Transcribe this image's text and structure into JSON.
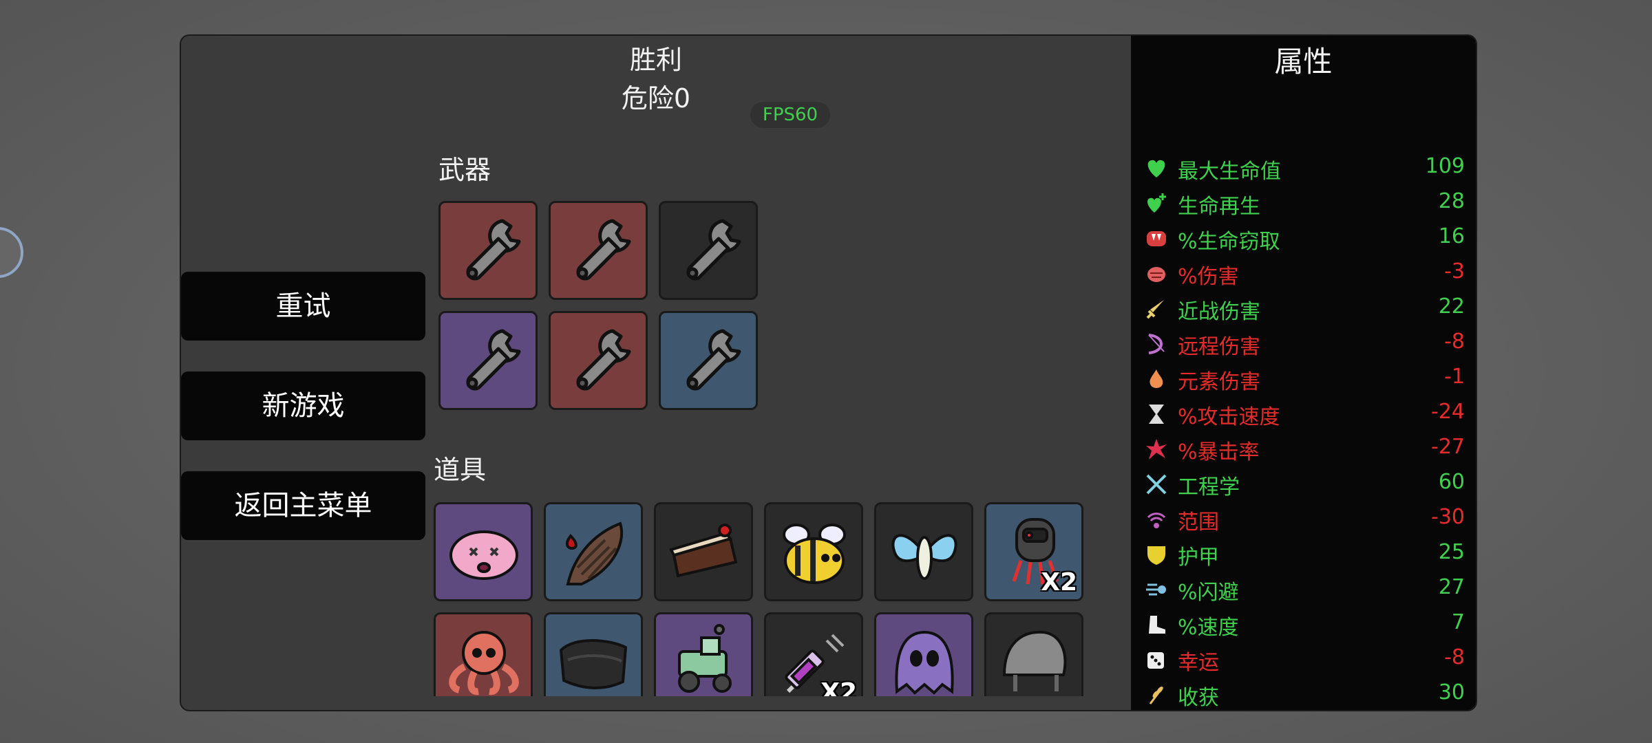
{
  "header": {
    "result": "胜利",
    "danger": "危险0",
    "fps": "FPS60"
  },
  "menu": {
    "retry": "重试",
    "new_game": "新游戏",
    "main_menu": "返回主菜单"
  },
  "weapons": {
    "label": "武器",
    "slots": [
      {
        "icon": "wrench-icon",
        "tier_color": "#7a3d3d"
      },
      {
        "icon": "wrench-icon",
        "tier_color": "#7a3d3d"
      },
      {
        "icon": "wrench-icon",
        "tier_color": "#2a2a2a"
      },
      {
        "icon": "wrench-icon",
        "tier_color": "#5f4a80"
      },
      {
        "icon": "wrench-icon",
        "tier_color": "#7a3d3d"
      },
      {
        "icon": "wrench-icon",
        "tier_color": "#3f5870"
      }
    ]
  },
  "items": {
    "label": "道具",
    "slots": [
      {
        "icon": "pink-blob-icon",
        "tier_color": "#5f4a80",
        "count": ""
      },
      {
        "icon": "bleeding-larva-icon",
        "tier_color": "#3f5870",
        "count": ""
      },
      {
        "icon": "cake-slice-icon",
        "tier_color": "#2a2a2a",
        "count": ""
      },
      {
        "icon": "bee-icon",
        "tier_color": "#2a2a2a",
        "count": ""
      },
      {
        "icon": "butterfly-icon",
        "tier_color": "#2a2a2a",
        "count": ""
      },
      {
        "icon": "robot-spider-icon",
        "tier_color": "#3f5870",
        "count": "X2"
      },
      {
        "icon": "octopus-icon",
        "tier_color": "#7a3d3d",
        "count": ""
      },
      {
        "icon": "dark-cloth-icon",
        "tier_color": "#3f5870",
        "count": ""
      },
      {
        "icon": "tractor-icon",
        "tier_color": "#5f4a80",
        "count": ""
      },
      {
        "icon": "syringe-icon",
        "tier_color": "#2a2a2a",
        "count": "X2"
      },
      {
        "icon": "ghost-blob-icon",
        "tier_color": "#5f4a80",
        "count": ""
      },
      {
        "icon": "helmet-icon",
        "tier_color": "#2a2a2a",
        "count": ""
      }
    ]
  },
  "stats": {
    "title": "属性",
    "rows": [
      {
        "icon": "heart-icon",
        "label": "最大生命值",
        "value": "109",
        "color": "#3fd14e",
        "icon_color": "#3fd14e"
      },
      {
        "icon": "heart-plus-icon",
        "label": "生命再生",
        "value": "28",
        "color": "#3fd14e",
        "icon_color": "#3fd14e"
      },
      {
        "icon": "fangs-icon",
        "label": "%生命窃取",
        "value": "16",
        "color": "#3fd14e",
        "icon_color": "#d84040"
      },
      {
        "icon": "brain-icon",
        "label": "%伤害",
        "value": "-3",
        "color": "#e62b2b",
        "icon_color": "#e06060"
      },
      {
        "icon": "sword-icon",
        "label": "近战伤害",
        "value": "22",
        "color": "#3fd14e",
        "icon_color": "#e8d070"
      },
      {
        "icon": "bow-icon",
        "label": "远程伤害",
        "value": "-8",
        "color": "#e62b2b",
        "icon_color": "#c070d0"
      },
      {
        "icon": "flame-icon",
        "label": "元素伤害",
        "value": "-1",
        "color": "#e62b2b",
        "icon_color": "#f09050"
      },
      {
        "icon": "hourglass-icon",
        "label": "%攻击速度",
        "value": "-24",
        "color": "#e62b2b",
        "icon_color": "#dddddd"
      },
      {
        "icon": "crit-burst-icon",
        "label": "%暴击率",
        "value": "-27",
        "color": "#e62b2b",
        "icon_color": "#e03050"
      },
      {
        "icon": "crossed-tools-icon",
        "label": "工程学",
        "value": "60",
        "color": "#3fd14e",
        "icon_color": "#80d0e0"
      },
      {
        "icon": "range-waves-icon",
        "label": "范围",
        "value": "-30",
        "color": "#e62b2b",
        "icon_color": "#c060c0"
      },
      {
        "icon": "shield-icon",
        "label": "护甲",
        "value": "25",
        "color": "#3fd14e",
        "icon_color": "#e8d030"
      },
      {
        "icon": "dash-icon",
        "label": "%闪避",
        "value": "27",
        "color": "#3fd14e",
        "icon_color": "#80c0e0"
      },
      {
        "icon": "boot-icon",
        "label": "%速度",
        "value": "7",
        "color": "#3fd14e",
        "icon_color": "#eeeeee"
      },
      {
        "icon": "dice-icon",
        "label": "幸运",
        "value": "-8",
        "color": "#e62b2b",
        "icon_color": "#eeeeee"
      },
      {
        "icon": "wheat-icon",
        "label": "收获",
        "value": "30",
        "color": "#3fd14e",
        "icon_color": "#e8c060"
      }
    ]
  }
}
